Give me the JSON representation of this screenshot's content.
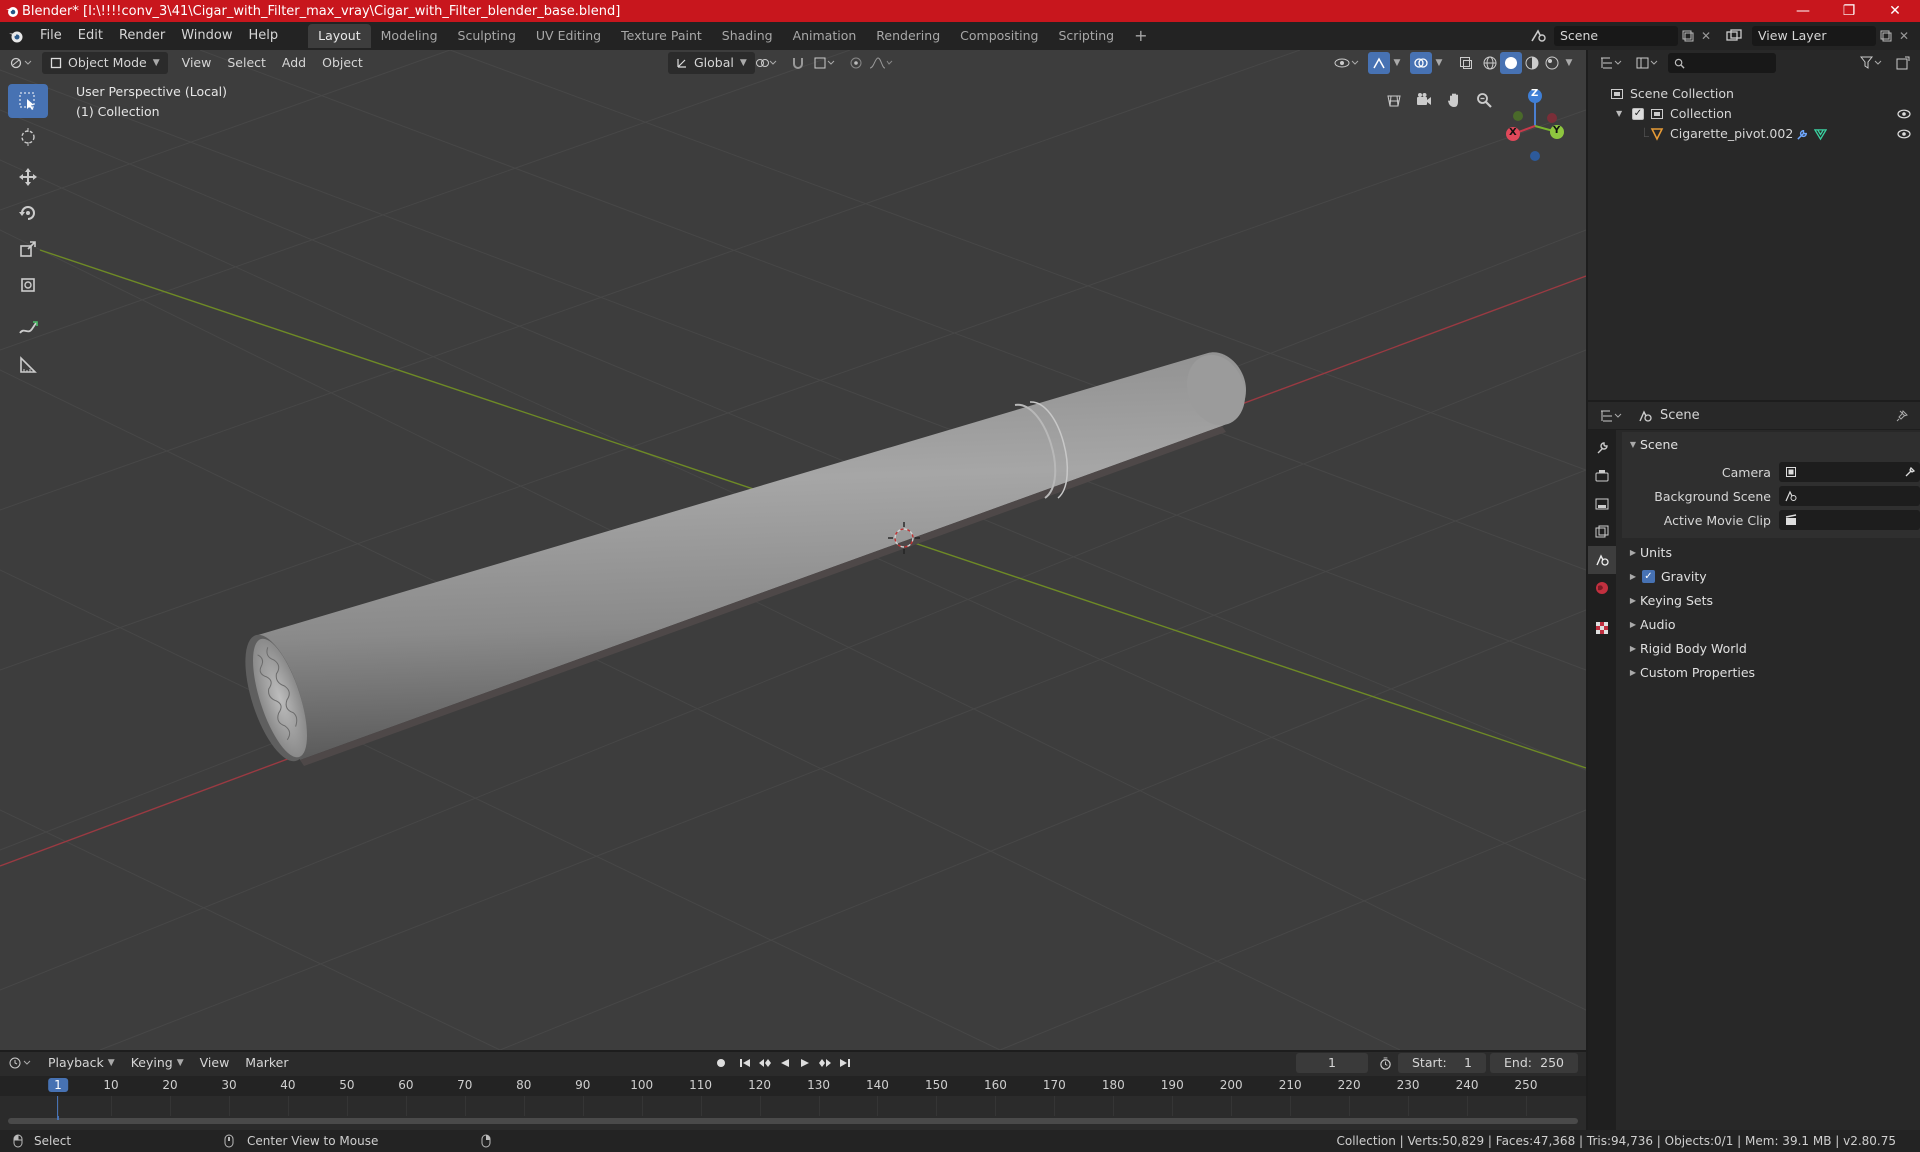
{
  "window": {
    "title": "Blender* [I:\\!!!!conv_3\\41\\Cigar_with_Filter_max_vray\\Cigar_with_Filter_blender_base.blend]",
    "minimize": "—",
    "maximize": "❐",
    "close": "✕"
  },
  "menu": [
    "File",
    "Edit",
    "Render",
    "Window",
    "Help"
  ],
  "workspaces": [
    "Layout",
    "Modeling",
    "Sculpting",
    "UV Editing",
    "Texture Paint",
    "Shading",
    "Animation",
    "Rendering",
    "Compositing",
    "Scripting"
  ],
  "workspace_add": "+",
  "scene_field": "Scene",
  "view_layer_field": "View Layer",
  "viewport": {
    "mode": "Object Mode",
    "menus": [
      "View",
      "Select",
      "Add",
      "Object"
    ],
    "transform": "Global",
    "perspective": "User Perspective (Local)",
    "collection": "(1) Collection",
    "gizmo": {
      "z": "Z",
      "y": "Y",
      "x": "X"
    }
  },
  "outliner": {
    "search_placeholder": "",
    "root": "Scene Collection",
    "collection": "Collection",
    "object": "Cigarette_pivot.002"
  },
  "properties": {
    "context": "Scene",
    "panel": "Scene",
    "camera_label": "Camera",
    "background_label": "Background Scene",
    "clip_label": "Active Movie Clip",
    "subpanels": [
      "Units",
      "Gravity",
      "Keying Sets",
      "Audio",
      "Rigid Body World",
      "Custom Properties"
    ]
  },
  "timeline": {
    "menus": [
      "Playback",
      "Keying",
      "View",
      "Marker"
    ],
    "current_frame": "1",
    "start_label": "Start:",
    "start": "1",
    "end_label": "End:",
    "end": "250",
    "ticks": [
      "1",
      "10",
      "20",
      "30",
      "40",
      "50",
      "60",
      "70",
      "80",
      "90",
      "100",
      "110",
      "120",
      "130",
      "140",
      "150",
      "160",
      "170",
      "180",
      "190",
      "200",
      "210",
      "220",
      "230",
      "240",
      "250"
    ]
  },
  "status": {
    "select": "Select",
    "center": "Center View to Mouse",
    "stats": "Collection | Verts:50,829 | Faces:47,368 | Tris:94,736 | Objects:0/1 | Mem: 39.1 MB | v2.80.75"
  },
  "colors": {
    "title_bar": "#c8161d",
    "accent": "#4772b3",
    "viewport_bg": "#3d3d3d",
    "x_axis": "#b53a44",
    "y_axis": "#7a9a2a"
  }
}
